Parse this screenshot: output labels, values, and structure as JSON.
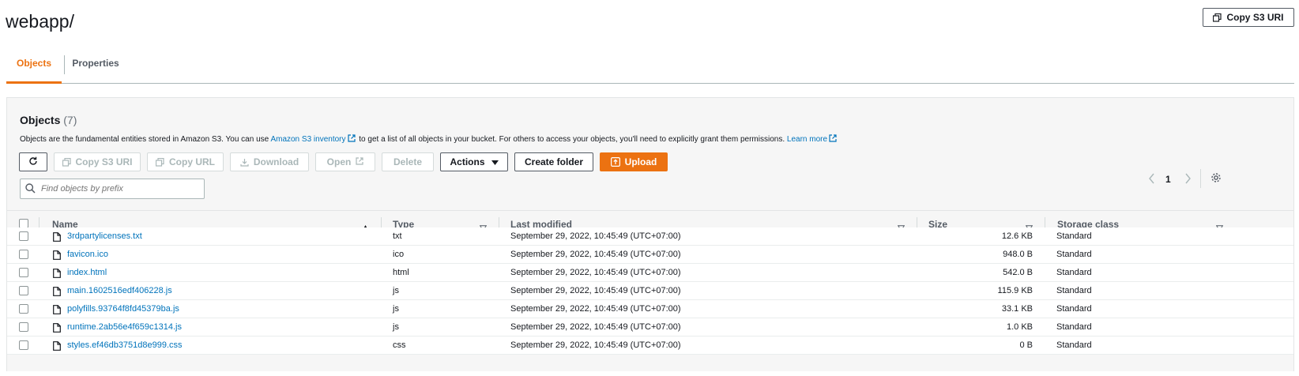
{
  "page": {
    "title": "webapp/",
    "copy_s3_uri_label": "Copy S3 URI"
  },
  "tabs": [
    {
      "label": "Objects",
      "active": true
    },
    {
      "label": "Properties",
      "active": false
    }
  ],
  "objects_panel": {
    "title": "Objects",
    "count": "(7)",
    "description_prefix": "Objects are the fundamental entities stored in Amazon S3. You can use ",
    "inventory_link": "Amazon S3 inventory",
    "description_middle": " to get a list of all objects in your bucket. For others to access your objects, you'll need to explicitly grant them permissions. ",
    "learn_more_link": "Learn more",
    "toolbar": {
      "refresh_icon": "refresh-icon",
      "copy_s3_uri": "Copy S3 URI",
      "copy_url": "Copy URL",
      "download": "Download",
      "open": "Open",
      "delete": "Delete",
      "actions": "Actions",
      "create_folder": "Create folder",
      "upload": "Upload"
    },
    "search_placeholder": "Find objects by prefix",
    "pagination": {
      "current_page": "1"
    },
    "columns": [
      "Name",
      "Type",
      "Last modified",
      "Size",
      "Storage class"
    ],
    "rows": [
      {
        "name": "3rdpartylicenses.txt",
        "type": "txt",
        "last_modified": "September 29, 2022, 10:45:49 (UTC+07:00)",
        "size": "12.6 KB",
        "storage_class": "Standard"
      },
      {
        "name": "favicon.ico",
        "type": "ico",
        "last_modified": "September 29, 2022, 10:45:49 (UTC+07:00)",
        "size": "948.0 B",
        "storage_class": "Standard"
      },
      {
        "name": "index.html",
        "type": "html",
        "last_modified": "September 29, 2022, 10:45:49 (UTC+07:00)",
        "size": "542.0 B",
        "storage_class": "Standard"
      },
      {
        "name": "main.1602516edf406228.js",
        "type": "js",
        "last_modified": "September 29, 2022, 10:45:49 (UTC+07:00)",
        "size": "115.9 KB",
        "storage_class": "Standard"
      },
      {
        "name": "polyfills.93764f8fd45379ba.js",
        "type": "js",
        "last_modified": "September 29, 2022, 10:45:49 (UTC+07:00)",
        "size": "33.1 KB",
        "storage_class": "Standard"
      },
      {
        "name": "runtime.2ab56e4f659c1314.js",
        "type": "js",
        "last_modified": "September 29, 2022, 10:45:49 (UTC+07:00)",
        "size": "1.0 KB",
        "storage_class": "Standard"
      },
      {
        "name": "styles.ef46db3751d8e999.css",
        "type": "css",
        "last_modified": "September 29, 2022, 10:45:49 (UTC+07:00)",
        "size": "0 B",
        "storage_class": "Standard"
      }
    ]
  },
  "colors": {
    "accent": "#ec7211",
    "link": "#0073bb",
    "text": "#16191f",
    "muted": "#545b64",
    "disabled": "#aab7b8"
  }
}
